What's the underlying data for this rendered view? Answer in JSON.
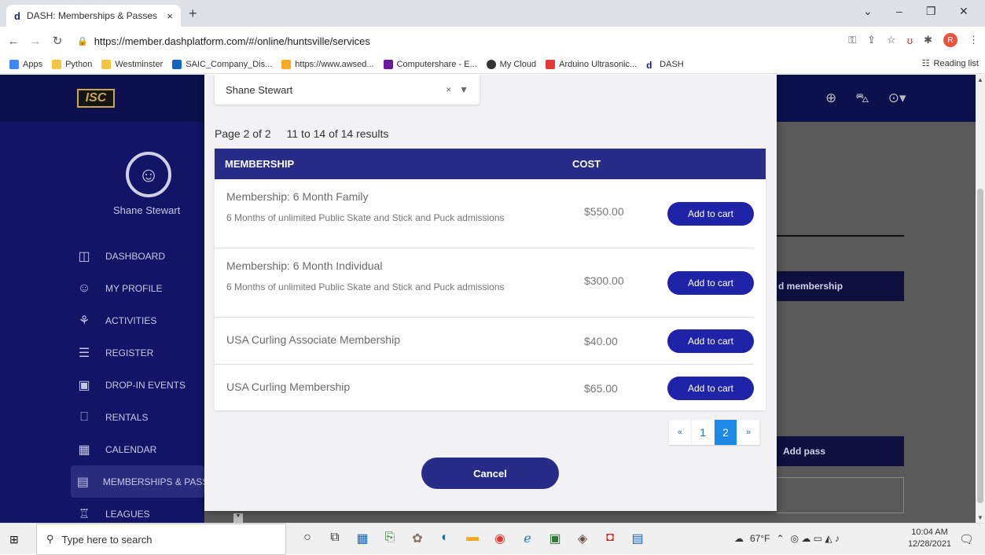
{
  "browser": {
    "tab_title": "DASH: Memberships & Passes",
    "tab_favicon": "d",
    "tab_close": "×",
    "new_tab": "+",
    "url": "https://member.dashplatform.com/#/online/huntsville/services",
    "profile_initial": "R",
    "window_controls": [
      "⌄",
      "–",
      "❐",
      "✕"
    ]
  },
  "bookmarks": {
    "items": [
      "Apps",
      "Python",
      "Westminster",
      "SAIC_Company_Dis...",
      "https://www.awsed...",
      "Computershare - E...",
      "My Cloud",
      "Arduino Ultrasonic...",
      "DASH"
    ],
    "reading_list": "Reading list"
  },
  "app": {
    "logo_text": "ISC",
    "user_name": "Shane Stewart",
    "menu": [
      {
        "label": "DASHBOARD",
        "icon": "◫"
      },
      {
        "label": "MY PROFILE",
        "icon": "☺"
      },
      {
        "label": "ACTIVITIES",
        "icon": "⚘"
      },
      {
        "label": "REGISTER",
        "icon": "☰"
      },
      {
        "label": "DROP-IN EVENTS",
        "icon": "▣"
      },
      {
        "label": "RENTALS",
        "icon": "⎕"
      },
      {
        "label": "CALENDAR",
        "icon": "▦"
      },
      {
        "label": "MEMBERSHIPS & PASSES",
        "icon": "▤"
      },
      {
        "label": "LEAGUES",
        "icon": "♖"
      }
    ],
    "background_buttons": {
      "membership": "d membership",
      "pass": "Add pass"
    }
  },
  "modal": {
    "selected_member": "Shane Stewart",
    "select_clear": "×",
    "page_info": "Page 2 of 2",
    "results_info": "11 to 14 of 14 results",
    "columns": [
      "MEMBERSHIP",
      "COST"
    ],
    "rows": [
      {
        "name": "Membership: 6 Month Family",
        "description": "6 Months of unlimited Public Skate and Stick and Puck admissions",
        "cost": "$550.00",
        "action": "Add to cart"
      },
      {
        "name": "Membership: 6 Month Individual",
        "description": "6 Months of unlimited Public Skate and Stick and Puck admissions",
        "cost": "$300.00",
        "action": "Add to cart"
      },
      {
        "name": "USA Curling Associate Membership",
        "description": "",
        "cost": "$40.00",
        "action": "Add to cart"
      },
      {
        "name": "USA Curling Membership",
        "description": "",
        "cost": "$65.00",
        "action": "Add to cart"
      }
    ],
    "pagination": {
      "prev": "«",
      "pages": [
        "1",
        "2"
      ],
      "current": "2",
      "next": "»"
    },
    "cancel_label": "Cancel"
  },
  "taskbar": {
    "search_placeholder": "Type here to search",
    "weather": "67°F",
    "time": "10:04 AM",
    "date": "12/28/2021"
  }
}
